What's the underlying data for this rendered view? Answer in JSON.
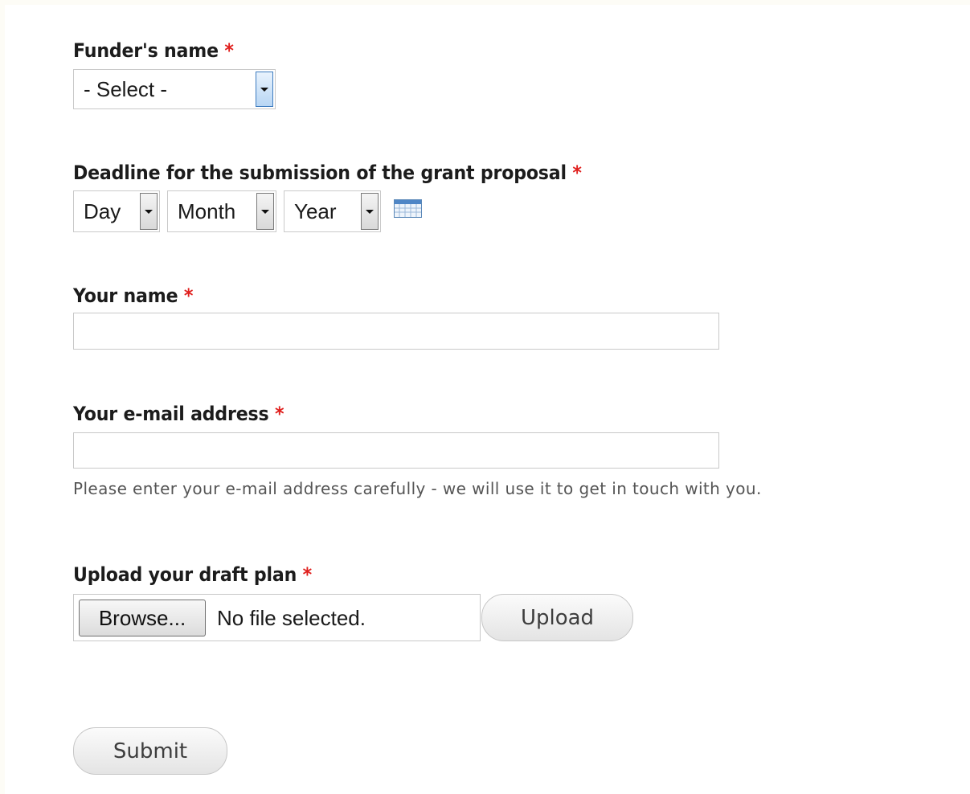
{
  "form": {
    "funder": {
      "label": "Funder's name",
      "required_mark": "*",
      "select_value": "- Select -"
    },
    "deadline": {
      "label": "Deadline for the submission of the grant proposal",
      "required_mark": "*",
      "day_value": "Day",
      "month_value": "Month",
      "year_value": "Year",
      "calendar_icon": "calendar-icon"
    },
    "name": {
      "label": "Your name",
      "required_mark": "*",
      "value": ""
    },
    "email": {
      "label": "Your e-mail address",
      "required_mark": "*",
      "value": "",
      "description": "Please enter your e-mail address carefully - we will use it to get in touch with you."
    },
    "upload": {
      "label": "Upload your draft plan",
      "required_mark": "*",
      "browse_label": "Browse...",
      "file_status": "No file selected.",
      "upload_label": "Upload"
    },
    "submit_label": "Submit"
  },
  "colors": {
    "required": "#e0201e",
    "page_background": "#fdfcf6"
  }
}
